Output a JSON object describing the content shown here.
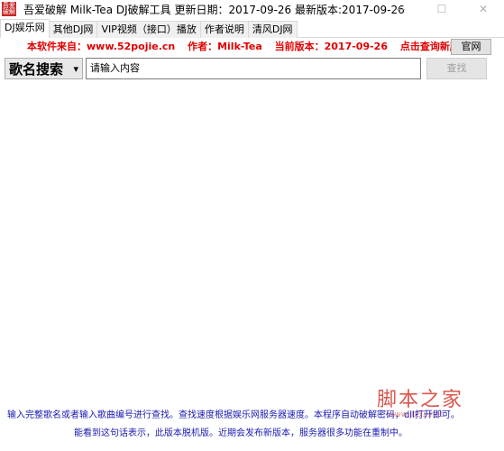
{
  "window": {
    "title": "吾爱破解  Milk-Tea    DJ破解工具    更新日期：2017-09-26    最新版本:2017-09-26",
    "icon": "app-logo-icon",
    "controls": {
      "minimize": "—",
      "maximize": "☐",
      "close": "✕"
    }
  },
  "tabs": [
    {
      "label": "DJ娱乐网",
      "active": true
    },
    {
      "label": "其他DJ网",
      "active": false
    },
    {
      "label": "VIP视频（接口）播放",
      "active": false
    },
    {
      "label": "作者说明",
      "active": false
    },
    {
      "label": "清风DJ网",
      "active": false
    }
  ],
  "info": {
    "source": "本软件来自：www.52pojie.cn",
    "author": "作者：Milk-Tea",
    "version": "当前版本：2017-09-26",
    "check": "点击查询新版本"
  },
  "official_button": "官网",
  "search": {
    "type_selected": "歌名搜索",
    "input_value": "请输入内容",
    "button": "查找"
  },
  "footer": {
    "line1": "输入完整歌名或者输入歌曲编号进行查找。查找速度根据娱乐网服务器速度。本程序自动破解密码，dll打开即可。",
    "line2": "能看到这句话表示，此版本脱机版。近期会发布新版本，服务器很多功能在重制中。"
  },
  "watermark": {
    "text": "脚本之家",
    "url": "www.jb51.net"
  },
  "colors": {
    "accent_red": "#e00000",
    "footer_blue": "#1a1ab0"
  }
}
